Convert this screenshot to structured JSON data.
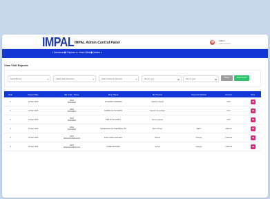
{
  "header": {
    "logo_text": "IMPAL",
    "title": "IMPAL Admin Control Panel",
    "user_name": "Admin",
    "user_role": "Administrator"
  },
  "nav": {
    "items": [
      {
        "label": "Dashboard",
        "icon": "dashboard-icon",
        "glyph": "⌂"
      },
      {
        "label": "Reports",
        "icon": "reports-icon",
        "glyph": "▤",
        "chevron": "▾"
      },
      {
        "label": "Head Office",
        "icon": "building-icon",
        "glyph": "⌂"
      },
      {
        "label": "Master",
        "icon": "master-icon",
        "glyph": "▣",
        "chevron": "▾"
      }
    ]
  },
  "page": {
    "title": "View Visit Reports"
  },
  "filters": {
    "branch": "Select Branch",
    "sales_executive": "Select Sales Executive",
    "customer": "Select Customer Name(s)",
    "from_date": "dd-mm-yyyy",
    "to_date": "dd-mm-yyyy",
    "reset_label": "Reset",
    "export_label": "Export Excel"
  },
  "table": {
    "columns": [
      "S.No",
      "Report Date",
      "SE Code - Name",
      "Shop Name",
      "Met Person",
      "Payment Method",
      "Amount",
      "View"
    ],
    "rows": [
      {
        "sno": "1",
        "date": "13 Mar 2025",
        "se_code": "3044",
        "se_name": "PRAVEEN",
        "shop": "JAYAMMA TRADERS",
        "met": "Jebaraj (owner)",
        "payment": "",
        "amount": "0.00"
      },
      {
        "sno": "2",
        "date": "13 Mar 2025",
        "se_code": "3044",
        "se_name": "PRAVEEN",
        "shop": "SUREN AUTO PARTS",
        "met": "Suresh (co-worker)",
        "payment": "",
        "amount": "0.00"
      },
      {
        "sno": "3",
        "date": "13 Mar 2025",
        "se_code": "3044",
        "se_name": "PRAVEEN",
        "shop": "KAR AUTO PARTS",
        "met": "Jenny (owner)",
        "payment": "",
        "amount": "0.00"
      },
      {
        "sno": "4",
        "date": "13 Mar 2025",
        "se_code": "3044",
        "se_name": "PRAVEEN",
        "shop": "SIVARAMAN AUTOMOBILE LTD",
        "met": "Siva (owner)",
        "payment": "NEFT",
        "amount": "1000.00"
      },
      {
        "sno": "5",
        "date": "13 Mar 2025",
        "se_code": "3278",
        "se_name": "MOHAN MURUGAN",
        "shop": "EAST MAIN MOTORS",
        "met": "Dinesh",
        "payment": "Cheque",
        "amount": "7,500.00"
      },
      {
        "sno": "6",
        "date": "13 Mar 2025",
        "se_code": "3278",
        "se_name": "MOHAN MURUGAN",
        "shop": "HOME MOTORS",
        "met": "Kumar",
        "payment": "Cheque",
        "amount": "7,852.00"
      }
    ]
  },
  "colors": {
    "primary": "#1336d6",
    "export": "#2cc46b",
    "view": "#e6217a",
    "reset": "#9e9e9e"
  }
}
